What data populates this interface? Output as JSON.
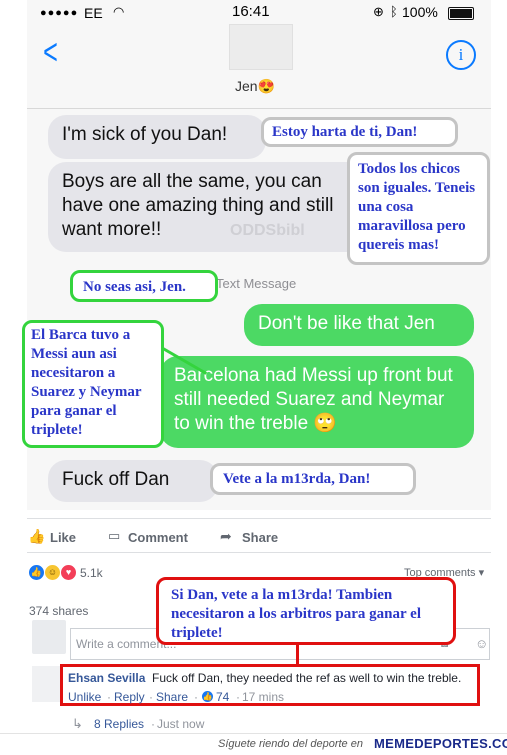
{
  "status_bar": {
    "signal": "●●●●●",
    "carrier": "EE",
    "time": "16:41",
    "battery": "100%"
  },
  "chat": {
    "contact": "Jen😍",
    "watermark": "ODDSbibl",
    "text_message_label": "Text Message",
    "messages": [
      {
        "side": "received",
        "text": "I'm sick of you Dan!"
      },
      {
        "side": "received",
        "text": "Boys are all the same, you can have one amazing thing and still want more!!"
      },
      {
        "side": "sent",
        "text": "Don't be like that Jen"
      },
      {
        "side": "sent",
        "text": "Barcelona had Messi up front but still needed Suarez and Neymar to win the treble 🙄"
      },
      {
        "side": "received",
        "text": "Fuck off Dan"
      }
    ]
  },
  "annotations": {
    "sick": "Estoy harta de ti, Dan!",
    "boys": "Todos los chicos son iguales. Teneis una cosa maravillosa pero quereis mas!",
    "nosea": "No seas asi, Jen.",
    "barca": "El Barca tuvo a Messi aun asi necesitaron a Suarez y Neymar para ganar el triplete!",
    "vete": "Vete a la m13rda, Dan!",
    "reply": "Si Dan, vete a la m13rda! Tambien necesitaron a los arbitros para ganar el triplete!"
  },
  "facebook": {
    "like": "Like",
    "comment": "Comment",
    "share": "Share",
    "reactions_count": "5.1k",
    "top_comments": "Top comments ▾",
    "shares": "374 shares",
    "comment_placeholder": "Write a comment...",
    "reply": {
      "author": "Ehsan Sevilla",
      "text": "Fuck off Dan, they needed the ref as well to win the treble.",
      "unlike": "Unlike",
      "reply": "Reply",
      "share": "Share",
      "likes": "74",
      "time": "17 mins"
    },
    "replies_link": "8 Replies",
    "replies_time": "Just now"
  },
  "footer": {
    "text": "Síguete riendo del deporte en",
    "brand": "MEMEDEPORTES.COM"
  },
  "colors": {
    "imessage_blue": "#0a7aff",
    "sent_green": "#4cd964",
    "received_gray": "#e5e5ea",
    "annotation_text": "#2a36c8",
    "annotation_green_border": "#34d43d",
    "annotation_red_border": "#e01010",
    "fb_link": "#365899"
  }
}
